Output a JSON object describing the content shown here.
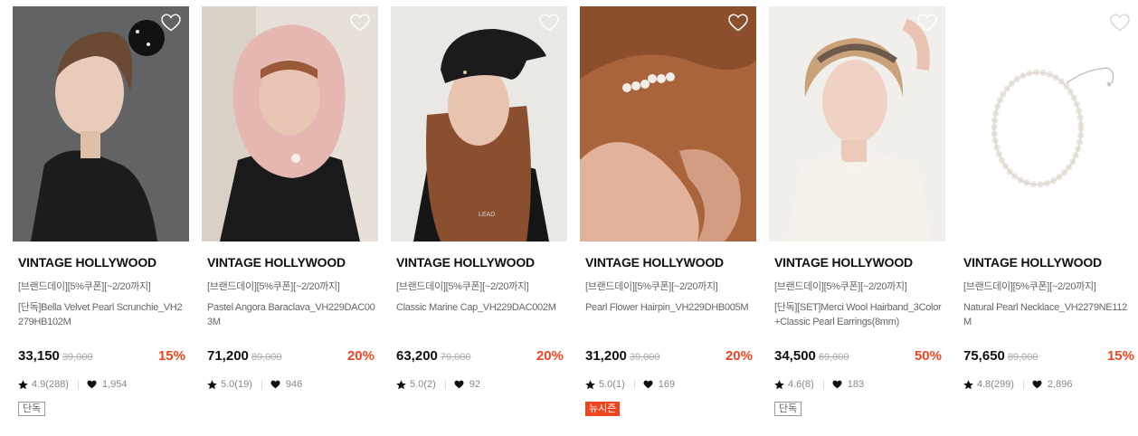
{
  "colors": {
    "discount": "#f0441f",
    "new_season_badge": "#f0441f"
  },
  "products": [
    {
      "brand": "VINTAGE HOLLYWOOD",
      "promo": "[브랜드데이][5%쿠폰][~2/20까지]",
      "name": "[단독]Bella Velvet Pearl Scrunchie_VH2279HB102M",
      "price": "33,150",
      "original_price": "39,000",
      "discount": "15%",
      "rating": "4.9(288)",
      "likes": "1,954",
      "badge": "단독"
    },
    {
      "brand": "VINTAGE HOLLYWOOD",
      "promo": "[브랜드데이][5%쿠폰][~2/20까지]",
      "name": "Pastel Angora Baraclava_VH229DAC003M",
      "price": "71,200",
      "original_price": "89,000",
      "discount": "20%",
      "rating": "5.0(19)",
      "likes": "946",
      "badge": ""
    },
    {
      "brand": "VINTAGE HOLLYWOOD",
      "promo": "[브랜드데이][5%쿠폰][~2/20까지]",
      "name": "Classic Marine Cap_VH229DAC002M",
      "price": "63,200",
      "original_price": "79,000",
      "discount": "20%",
      "rating": "5.0(2)",
      "likes": "92",
      "badge": ""
    },
    {
      "brand": "VINTAGE HOLLYWOOD",
      "promo": "[브랜드데이][5%쿠폰][~2/20까지]",
      "name": "Pearl Flower Hairpin_VH229DHB005M",
      "price": "31,200",
      "original_price": "39,000",
      "discount": "20%",
      "rating": "5.0(1)",
      "likes": "169",
      "badge": "뉴시즌"
    },
    {
      "brand": "VINTAGE HOLLYWOOD",
      "promo": "[브랜드데이][5%쿠폰][~2/20까지]",
      "name": "[단독][SET]Merci Wool Hairband_3Color+Classic Pearl Earrings(8mm)",
      "price": "34,500",
      "original_price": "69,000",
      "discount": "50%",
      "rating": "4.6(8)",
      "likes": "183",
      "badge": "단독"
    },
    {
      "brand": "VINTAGE HOLLYWOOD",
      "promo": "[브랜드데이][5%쿠폰][~2/20까지]",
      "name": "Natural Pearl Necklace_VH2279NE112M",
      "price": "75,650",
      "original_price": "89,000",
      "discount": "15%",
      "rating": "4.8(299)",
      "likes": "2,896",
      "badge": ""
    }
  ]
}
